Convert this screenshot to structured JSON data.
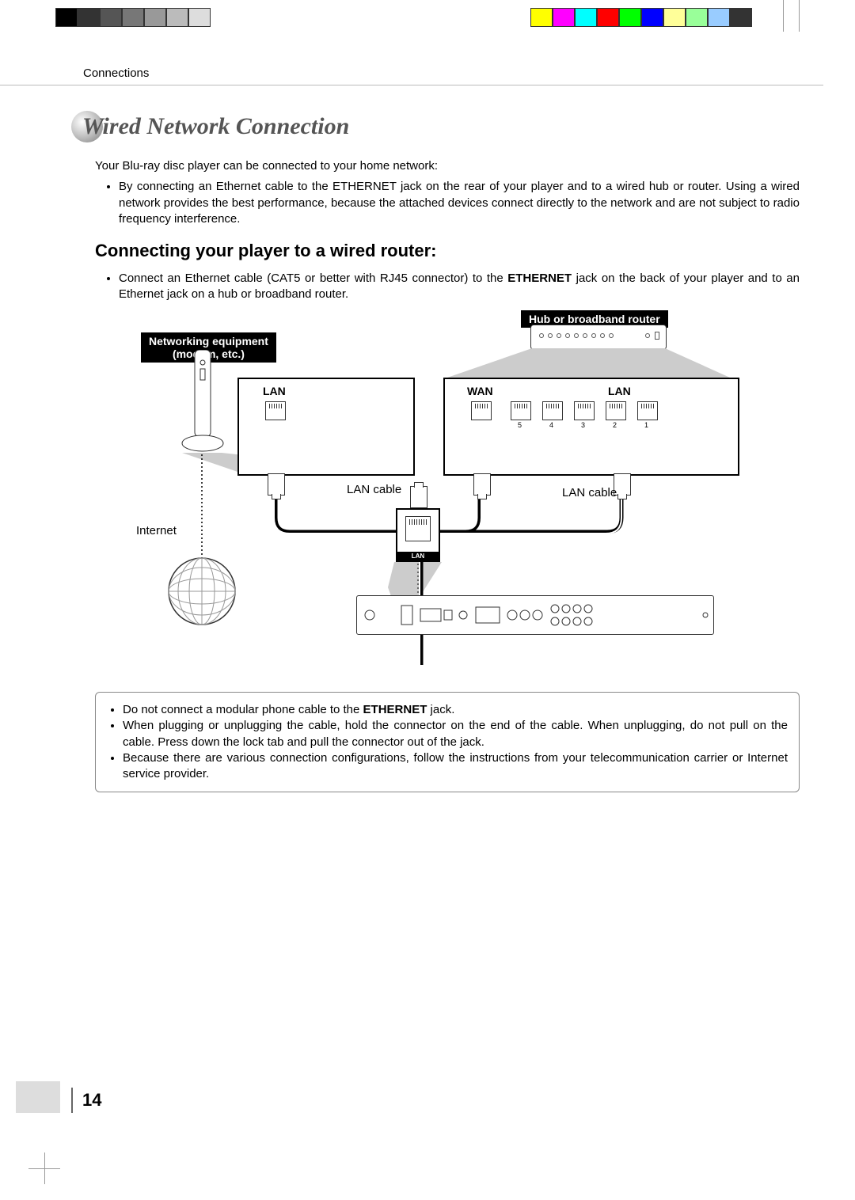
{
  "header_section": "Connections",
  "title": "Wired Network Connection",
  "intro_lead": "Your Blu-ray disc player can be connected to your home network:",
  "intro_bullet": "By connecting an Ethernet cable to the ETHERNET jack on the rear of your player and to a wired hub or router. Using a wired network provides the best performance, because the attached devices connect directly to the network and are not subject to radio frequency interference.",
  "subheading": "Connecting your player to a wired router:",
  "step_prefix": "Connect an Ethernet cable (CAT5 or better with RJ45 connector) to the ",
  "step_bold": "ETHERNET",
  "step_suffix": " jack on the back of your player and to an Ethernet jack on a hub or broadband router.",
  "diagram": {
    "modem_label_l1": "Networking equipment",
    "modem_label_l2": "(modem, etc.)",
    "router_label": "Hub or broadband router",
    "lan": "LAN",
    "wan": "WAN",
    "lan_cable": "LAN cable",
    "internet": "Internet",
    "jack_lan": "LAN",
    "port_nums": [
      "5",
      "4",
      "3",
      "2",
      "1"
    ]
  },
  "notes": {
    "n1a": "Do not connect a modular phone cable to the ",
    "n1b": "ETHERNET",
    "n1c": " jack.",
    "n2": "When plugging or unplugging the cable, hold the connector on the end of the cable. When unplugging, do not pull on the cable. Press down the lock tab and pull the connector out of the jack.",
    "n3": "Because there are various connection configurations, follow the instructions from your telecommunication carrier or Internet service provider."
  },
  "page_number": "14",
  "colorbars": {
    "left": [
      "#000000",
      "#333333",
      "#555555",
      "#777777",
      "#999999",
      "#bbbbbb",
      "#dddddd",
      "#ffffff"
    ],
    "right": [
      "#ffffff",
      "#ffff00",
      "#ff00ff",
      "#00ffff",
      "#ff0000",
      "#00ff00",
      "#0000ff",
      "#ffff99",
      "#99ff99",
      "#99ccff",
      "#333333"
    ]
  }
}
